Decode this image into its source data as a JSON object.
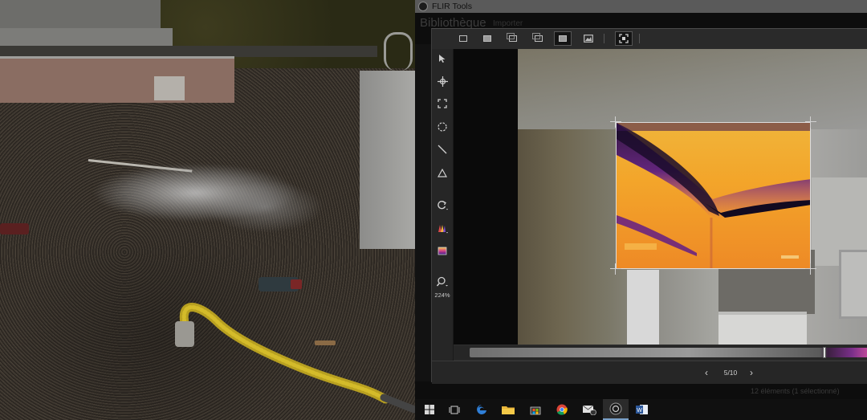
{
  "window": {
    "title": "FLIR Tools"
  },
  "background_ui": {
    "library_title": "Bibliothèque",
    "import_label": "Importer",
    "status_text": "12 éléments  (1 sélectionné)"
  },
  "toolbar": {
    "buttons": [
      "single-view-icon",
      "fill-view-icon",
      "picture-in-picture-icon",
      "overlay-icon",
      "thermal-only-icon",
      "visual-only-icon",
      "fullscreen-icon"
    ],
    "active": "thermal-only-icon"
  },
  "tools": [
    "select-arrow-icon",
    "spot-meter-icon",
    "box-area-icon",
    "ellipse-area-icon",
    "line-icon",
    "triangle-delta-icon",
    "rotate-icon",
    "palette-icon",
    "color-scale-icon",
    "zoom-icon"
  ],
  "zoom": {
    "level": "224%"
  },
  "navigation": {
    "page": "5/10",
    "prev": "‹",
    "next": "›"
  },
  "taskbar": {
    "items": [
      "windows-start-icon",
      "task-view-icon",
      "edge-icon",
      "file-explorer-icon",
      "store-icon",
      "chrome-icon",
      "mail-icon",
      "flir-tools-icon",
      "word-icon"
    ],
    "active": "flir-tools-icon",
    "mail_badge": "1"
  },
  "colors": {
    "accent": "#7aa0c8",
    "thermal_hot": "#f3a52a",
    "thermal_cold": "#1a1030"
  }
}
